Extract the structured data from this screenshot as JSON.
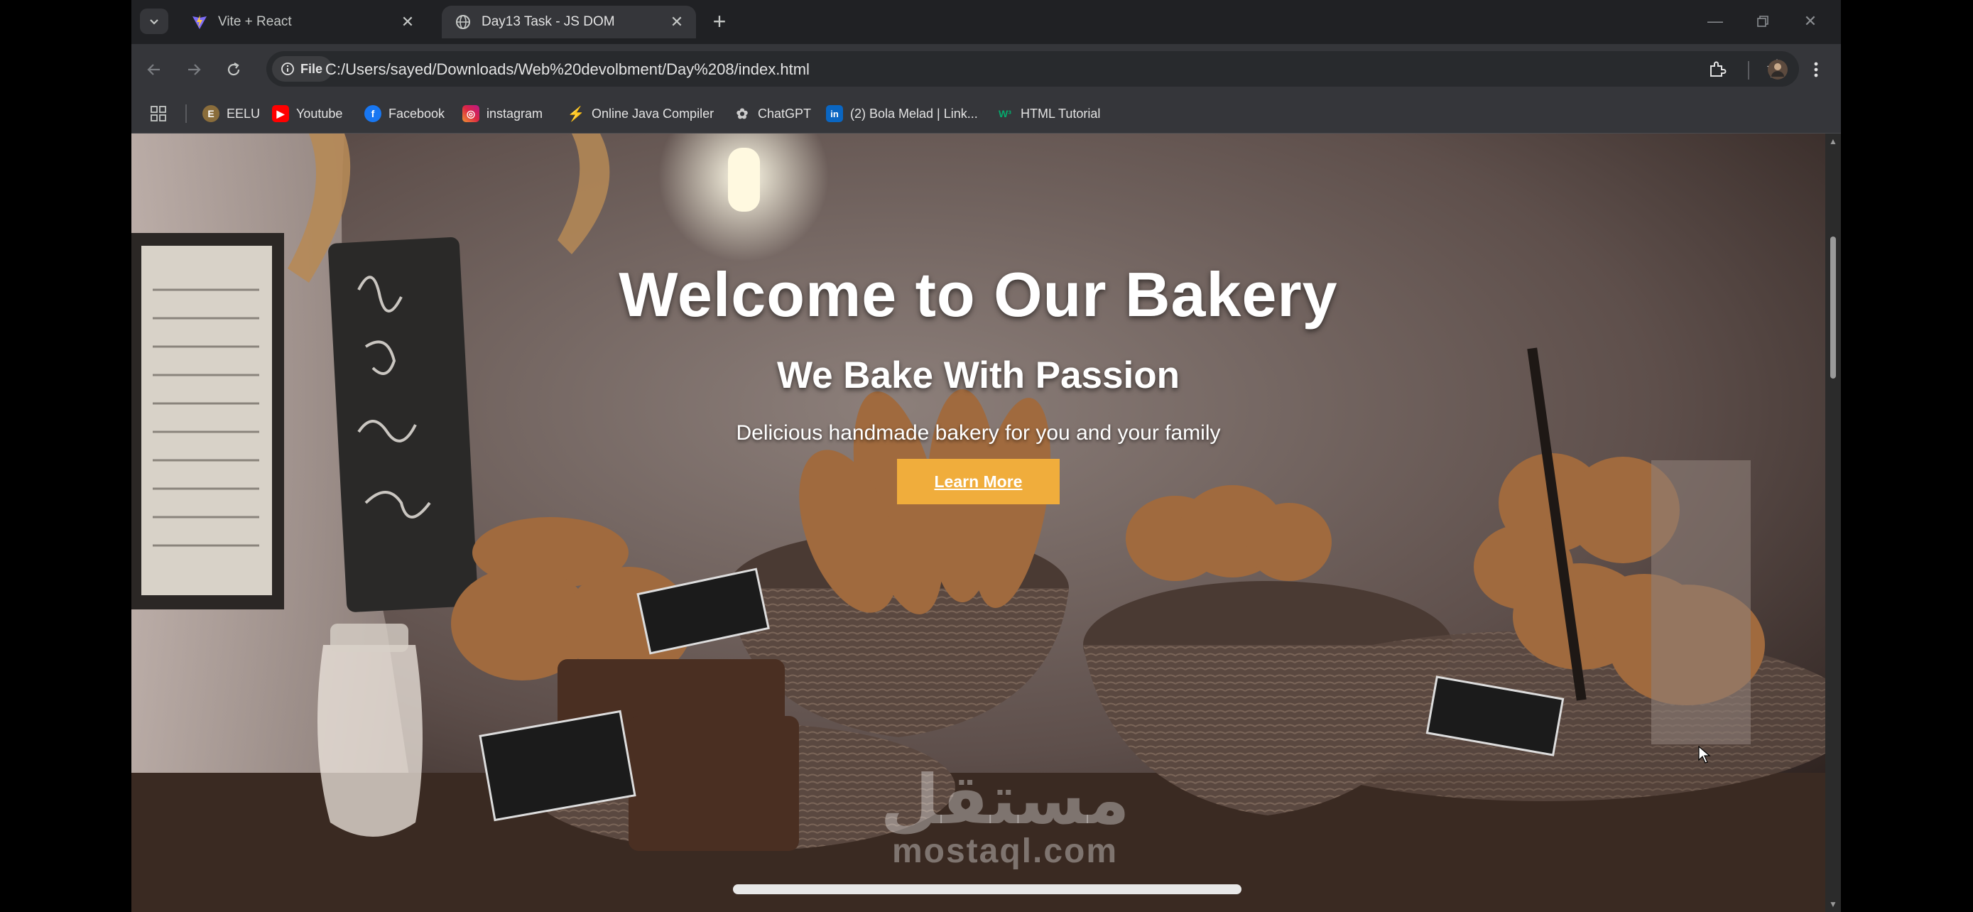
{
  "browser": {
    "tabs": [
      {
        "title": "Vite + React",
        "active": false,
        "icon": "vite-icon"
      },
      {
        "title": "Day13 Task - JS DOM",
        "active": true,
        "icon": "globe-icon"
      }
    ],
    "address": {
      "chip": "File",
      "url": "C:/Users/sayed/Downloads/Web%20devolbment/Day%208/index.html"
    },
    "bookmarks": [
      {
        "label": "EELU",
        "icon": "eelu-icon",
        "color": "#8a6d3b"
      },
      {
        "label": "Youtube",
        "icon": "youtube-icon",
        "color": "#ff0000"
      },
      {
        "label": "Facebook",
        "icon": "facebook-icon",
        "color": "#1877f2"
      },
      {
        "label": "instagram",
        "icon": "instagram-icon",
        "color": "#d6249f"
      },
      {
        "label": "Online Java Compiler",
        "icon": "java-icon",
        "color": "#4a90d9"
      },
      {
        "label": "ChatGPT",
        "icon": "chatgpt-icon",
        "color": "#cccccc"
      },
      {
        "label": "(2) Bola Melad | Link...",
        "icon": "linkedin-icon",
        "color": "#0a66c2"
      },
      {
        "label": "HTML Tutorial",
        "icon": "w3schools-icon",
        "color": "#04aa6d"
      }
    ]
  },
  "hero": {
    "title": "Welcome to Our Bakery",
    "subtitle": "We Bake With Passion",
    "description": "Delicious handmade bakery for you and your family",
    "button": "Learn More",
    "button_color": "#f0ad3c"
  },
  "watermark": {
    "arabic": "مستقل",
    "latin": "mostaql.com"
  }
}
